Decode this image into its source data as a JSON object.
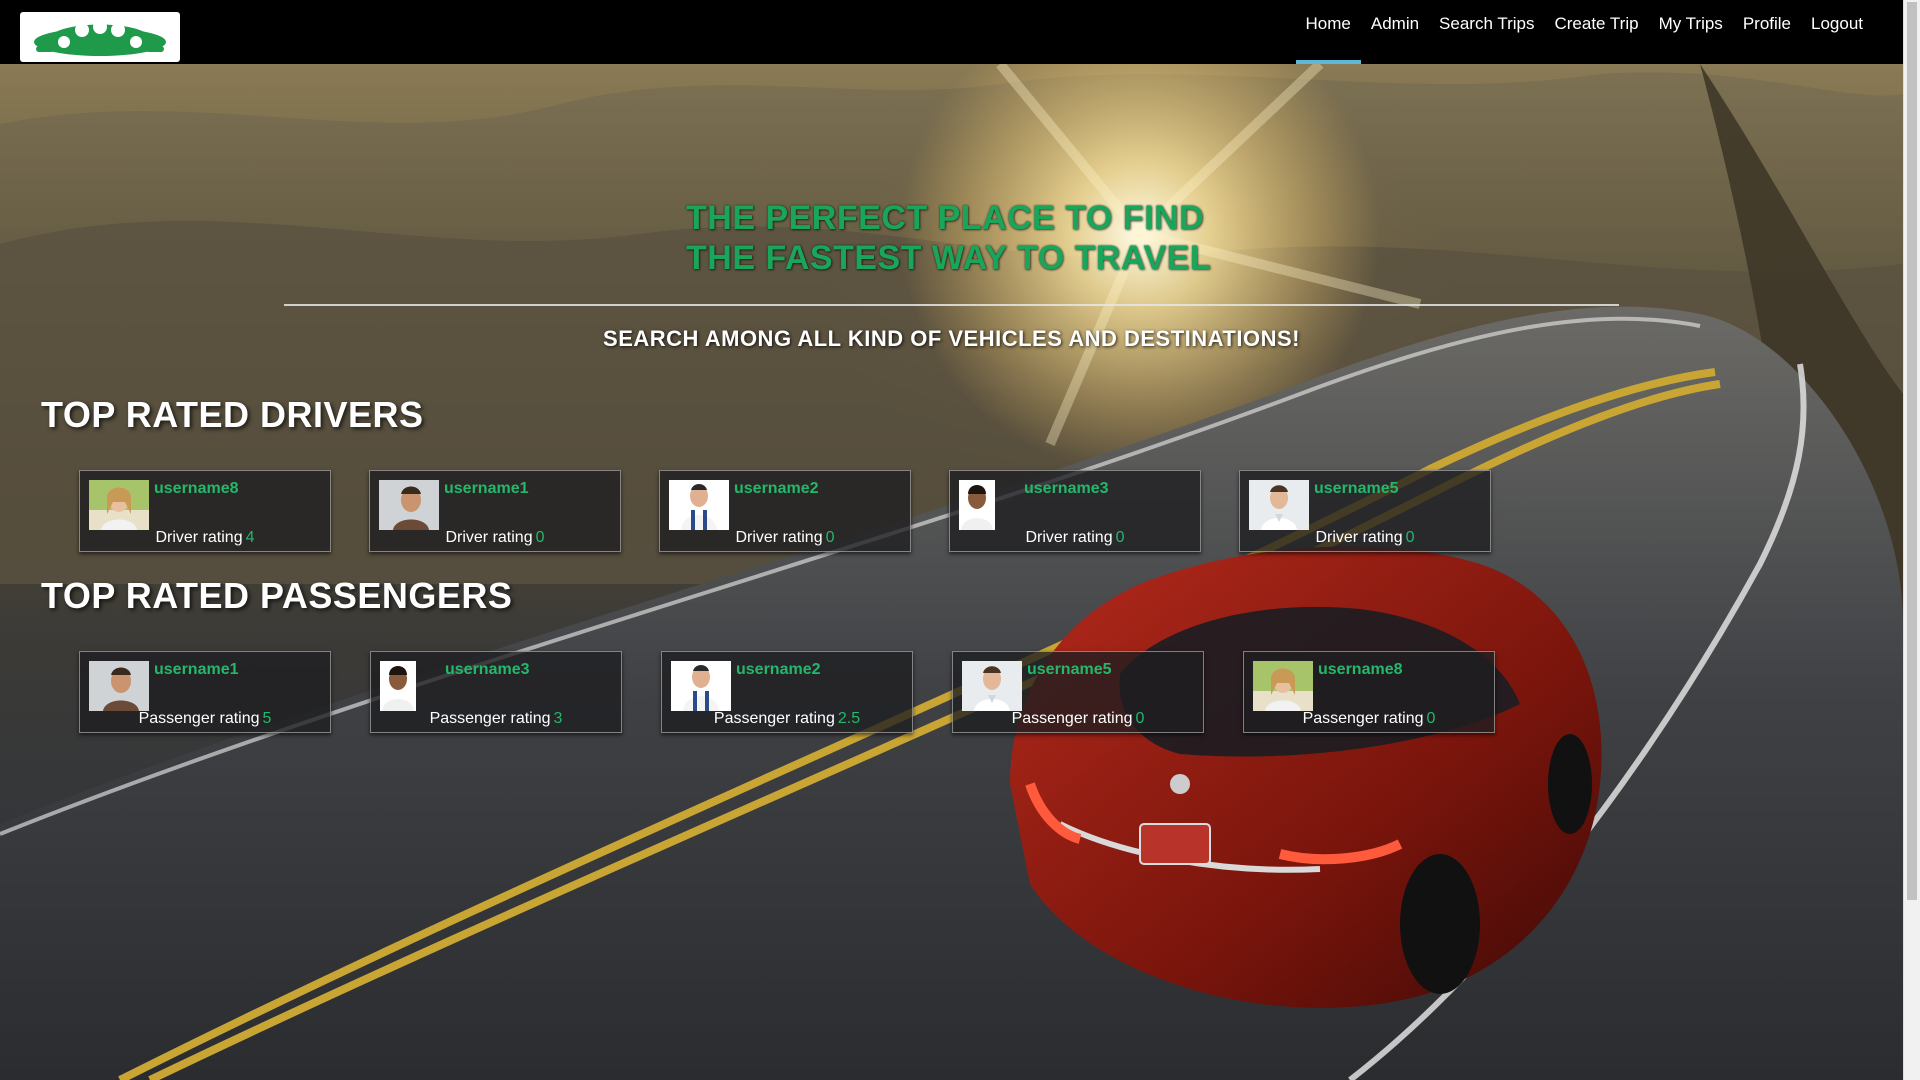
{
  "navbar": {
    "logo_label": "logo",
    "items": [
      {
        "label": "Home",
        "active": true
      },
      {
        "label": "Admin",
        "active": false
      },
      {
        "label": "Search Trips",
        "active": false
      },
      {
        "label": "Create Trip",
        "active": false
      },
      {
        "label": "My Trips",
        "active": false
      },
      {
        "label": "Profile",
        "active": false
      },
      {
        "label": "Logout",
        "active": false
      }
    ]
  },
  "hero": {
    "title_line1": "THE PERFECT PLACE TO FIND",
    "title_line2": "THE FASTEST WAY TO TRAVEL",
    "subtitle": "SEARCH AMONG ALL KIND OF VEHICLES AND DESTINATIONS!"
  },
  "drivers": {
    "title": "TOP RATED DRIVERS",
    "rating_label": "Driver rating",
    "cards": [
      {
        "username": "username8",
        "rating": "4",
        "avatar": "woman-avatar"
      },
      {
        "username": "username1",
        "rating": "0",
        "avatar": "man-avatar"
      },
      {
        "username": "username2",
        "rating": "0",
        "avatar": "worker-avatar"
      },
      {
        "username": "username3",
        "rating": "0",
        "avatar": "young-man-avatar"
      },
      {
        "username": "username5",
        "rating": "0",
        "avatar": "man-shirt-avatar"
      }
    ]
  },
  "passengers": {
    "title": "TOP RATED PASSENGERS",
    "rating_label": "Passenger rating",
    "cards": [
      {
        "username": "username1",
        "rating": "5",
        "avatar": "man-avatar"
      },
      {
        "username": "username3",
        "rating": "3",
        "avatar": "young-man-avatar"
      },
      {
        "username": "username2",
        "rating": "2.5",
        "avatar": "worker-avatar"
      },
      {
        "username": "username5",
        "rating": "0",
        "avatar": "man-shirt-avatar"
      },
      {
        "username": "username8",
        "rating": "0",
        "avatar": "woman-avatar"
      }
    ]
  },
  "colors": {
    "accent_green": "#23b86a",
    "active_tab_underline": "#5fb8d6",
    "navbar_bg": "#000000"
  }
}
